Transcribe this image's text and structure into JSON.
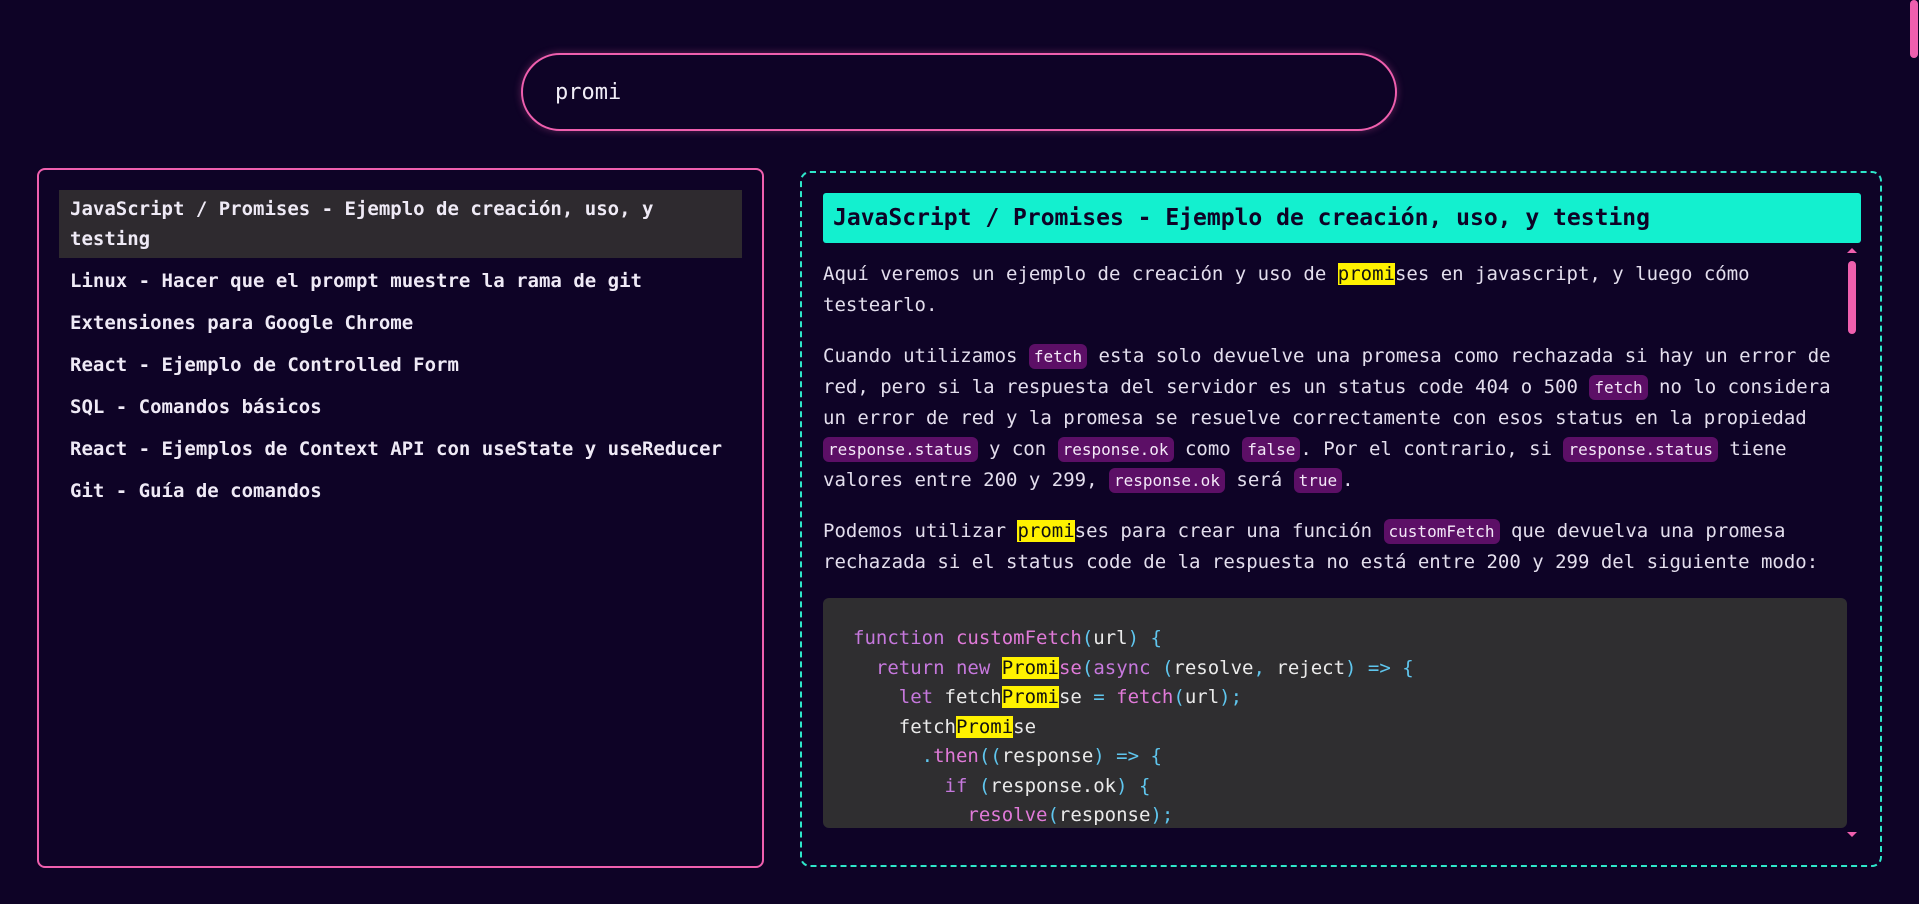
{
  "search": {
    "value": "promi"
  },
  "results": [
    {
      "label": "JavaScript / Promises - Ejemplo de creación, uso, y testing",
      "selected": true
    },
    {
      "label": "Linux - Hacer que el prompt muestre la rama de git"
    },
    {
      "label": "Extensiones para Google Chrome"
    },
    {
      "label": "React - Ejemplo de Controlled Form"
    },
    {
      "label": "SQL - Comandos básicos"
    },
    {
      "label": "React - Ejemplos de Context API con useState y useReducer"
    },
    {
      "label": "Git - Guía de comandos"
    }
  ],
  "preview": {
    "title": "JavaScript / Promises - Ejemplo de creación, uso, y testing",
    "p1": {
      "before": "Aquí veremos un ejemplo de creación y uso de ",
      "highlight": "promi",
      "after": "ses en javascript, y luego cómo testearlo."
    },
    "p2": {
      "t1": "Cuando utilizamos ",
      "c1": "fetch",
      "t2": " esta solo devuelve una promesa como rechazada si hay un error de red, pero si la respuesta del servidor es un status code 404 o 500 ",
      "c2": "fetch",
      "t3": " no lo considera un error de red y la promesa se resuelve correctamente con esos status en la propiedad ",
      "c3": "response.status",
      "t4": " y con ",
      "c4": "response.ok",
      "t5": " como ",
      "c5": "false",
      "t6": ". Por el contrario, si ",
      "c6": "response.status",
      "t7": " tiene valores entre 200 y 299, ",
      "c7": "response.ok",
      "t8": " será ",
      "c8": "true",
      "t9": "."
    },
    "p3": {
      "t1": "Podemos utilizar ",
      "highlight": "promi",
      "t2": "ses para crear una función ",
      "c1": "customFetch",
      "t3": " que devuelva una promesa rechazada si el status code de la respuesta no está entre 200 y 299 del siguiente modo:"
    },
    "code": {
      "l1_kw": "function",
      "l1_fn": "customFetch",
      "l1_p1": "(",
      "l1_arg": "url",
      "l1_p2": ") {",
      "l2_kw1": "return",
      "l2_kw2": "new",
      "l2_hl": "Promi",
      "l2_rest": "se",
      "l2_p1": "(",
      "l2_kw3": "async",
      "l2_p2": " (",
      "l2_a1": "resolve",
      "l2_p3": ", ",
      "l2_a2": "reject",
      "l2_p4": ") => {",
      "l3_kw": "let",
      "l3_v1": "fetch",
      "l3_hl": "Promi",
      "l3_v2": "se",
      "l3_op": " = ",
      "l3_fn": "fetch",
      "l3_p1": "(",
      "l3_arg": "url",
      "l3_p2": ");",
      "l4_v1": "fetch",
      "l4_hl": "Promi",
      "l4_v2": "se",
      "l5_dot": ".",
      "l5_fn": "then",
      "l5_p1": "((",
      "l5_arg": "response",
      "l5_p2": ") => {",
      "l6_kw": "if",
      "l6_p1": " (",
      "l6_arg": "response.ok",
      "l6_p2": ") {",
      "l7_fn": "resolve",
      "l7_p1": "(",
      "l7_arg": "response",
      "l7_p2": ");"
    }
  },
  "colors": {
    "background": "#0e0326",
    "accent_pink": "#ef5fae",
    "accent_teal": "#13f0cf",
    "highlight": "#fff200",
    "inline_code_bg": "#5c0f66"
  }
}
